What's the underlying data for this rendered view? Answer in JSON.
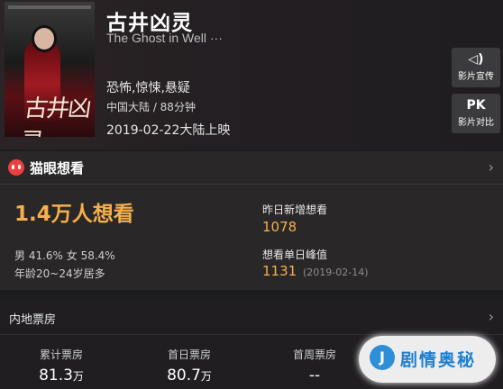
{
  "movie": {
    "poster_text": "古井凶灵",
    "title": "古井凶灵",
    "subtitle": "The Ghost in Well ···",
    "genres": "恐怖,惊悚,悬疑",
    "meta": "中国大陆 / 88分钟",
    "release": "2019-02-22大陆上映"
  },
  "side_buttons": [
    {
      "icon": "speaker-icon",
      "icon_glyph": "◁)",
      "label": "影片宣传"
    },
    {
      "icon": "pk-icon",
      "icon_glyph": "PK",
      "label": "影片对比"
    }
  ],
  "maoyan": {
    "title": "猫眼想看",
    "want_count": "1.4万人想看",
    "gender": "男 41.6% 女 58.4%",
    "age": "年龄20~24岁居多",
    "yesterday_label": "昨日新增想看",
    "yesterday_value": "1078",
    "peak_label": "想看单日峰值",
    "peak_value": "1131",
    "peak_date": "(2019-02-14)"
  },
  "box_office": {
    "title": "内地票房",
    "columns": [
      {
        "label": "累计票房",
        "value": "81.3",
        "unit": "万"
      },
      {
        "label": "首日票房",
        "value": "80.7",
        "unit": "万"
      },
      {
        "label": "首周票房",
        "value": "--",
        "unit": ""
      }
    ]
  },
  "watermark": {
    "text": "剧情奥秘"
  },
  "colors": {
    "accent": "#f6b04b",
    "brand_red": "#ee4040",
    "watermark_blue": "#1f7fd0"
  }
}
